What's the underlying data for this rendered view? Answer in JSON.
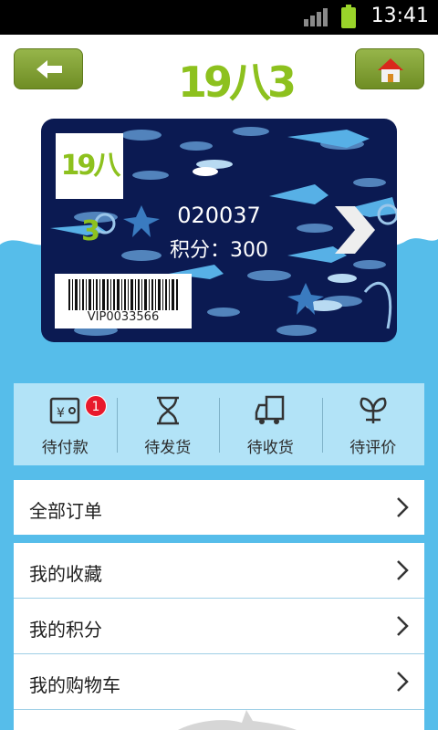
{
  "status_bar": {
    "time": "13:41",
    "signal_icon": "signal-bars-icon",
    "battery_icon": "battery-icon"
  },
  "header": {
    "back_icon": "back-arrow-icon",
    "home_icon": "home-icon",
    "logo_text": "19八3",
    "accent_color": "#8dc11e"
  },
  "card": {
    "logo_text": "19八3",
    "number": "020037",
    "points": "积分：300",
    "barcode_text": "VIP0033566",
    "background_color": "#0b1a52"
  },
  "order_tabs": [
    {
      "label": "待付款",
      "icon": "wallet-icon",
      "badge": "1"
    },
    {
      "label": "待发货",
      "icon": "hourglass-icon"
    },
    {
      "label": "待收货",
      "icon": "truck-icon"
    },
    {
      "label": "待评价",
      "icon": "sprout-icon"
    }
  ],
  "menu": {
    "all_orders": "全部订单",
    "favorites": "我的收藏",
    "points": "我的积分",
    "cart": "我的购物车"
  },
  "colors": {
    "sky_blue": "#56bdea",
    "tab_bg": "#b2e3f7",
    "badge_red": "#e8192c"
  }
}
